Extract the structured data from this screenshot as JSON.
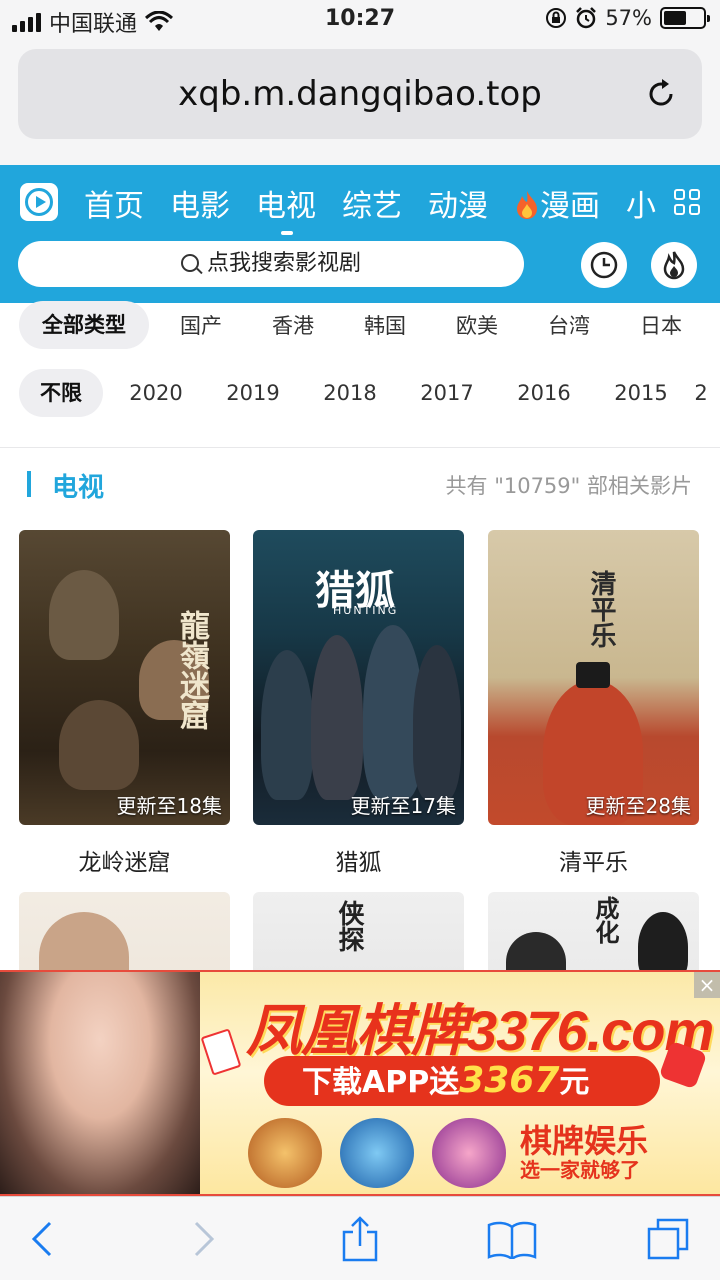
{
  "status_bar": {
    "carrier": "中国联通",
    "time": "10:27",
    "battery_percent": "57%",
    "battery_level": 0.57
  },
  "browser": {
    "url": "xqb.m.dangqibao.top"
  },
  "site_header": {
    "nav": [
      {
        "label": "首页"
      },
      {
        "label": "电影"
      },
      {
        "label": "电视",
        "active": true
      },
      {
        "label": "综艺"
      },
      {
        "label": "动漫"
      },
      {
        "label": "漫画",
        "icon": "fire-icon"
      },
      {
        "label": "小"
      }
    ],
    "search_placeholder": "点我搜索影视剧",
    "accent_color": "#21a6dc"
  },
  "filters": {
    "region": [
      "全部类型",
      "国产",
      "香港",
      "韩国",
      "欧美",
      "台湾",
      "日本"
    ],
    "year": [
      "不限",
      "2020",
      "2019",
      "2018",
      "2017",
      "2016",
      "2015",
      "2"
    ]
  },
  "section": {
    "title": "电视",
    "count_text": "共有 \"10759\" 部相关影片"
  },
  "items": [
    {
      "name": "龙岭迷窟",
      "badge": "更新至18集",
      "poster_title": "龍嶺迷窟"
    },
    {
      "name": "猎狐",
      "badge": "更新至17集",
      "poster_title": "猎狐",
      "poster_sub": "HUNTING"
    },
    {
      "name": "清平乐",
      "badge": "更新至28集",
      "poster_title": "清平乐"
    },
    {
      "poster_title": ""
    },
    {
      "poster_title": "侠探"
    },
    {
      "poster_title": "成化"
    }
  ],
  "ad": {
    "headline": "凤凰棋牌3376.com",
    "pill_prefix": "下载APP送",
    "pill_number": "3367",
    "pill_suffix": "元",
    "right_title": "棋牌娱乐",
    "right_sub": "选一家就够了",
    "close": "×"
  }
}
